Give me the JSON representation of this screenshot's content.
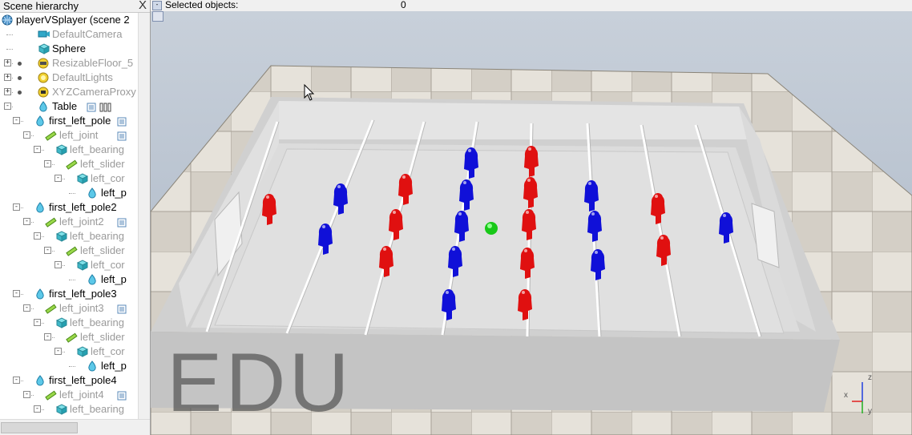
{
  "hierarchy": {
    "title": "Scene hierarchy",
    "close": "X",
    "items": [
      {
        "label": "playerVSplayer (scene 2",
        "icon": "world-icon",
        "color": "black"
      },
      {
        "label": "DefaultCamera",
        "icon": "camera-icon",
        "color": "gray"
      },
      {
        "label": "Sphere",
        "icon": "cube-icon",
        "color": "black"
      },
      {
        "label": "ResizableFloor_5",
        "icon": "floor-icon",
        "color": "gray"
      },
      {
        "label": "DefaultLights",
        "icon": "lights-icon",
        "color": "gray"
      },
      {
        "label": "XYZCameraProxy",
        "icon": "proxy-icon",
        "color": "gray"
      },
      {
        "label": "Table",
        "icon": "shape-icon",
        "color": "black"
      },
      {
        "label": "first_left_pole",
        "icon": "shape-icon",
        "color": "black"
      },
      {
        "label": "left_joint",
        "icon": "joint-icon",
        "color": "gray"
      },
      {
        "label": "left_bearing",
        "icon": "cube-icon",
        "color": "gray"
      },
      {
        "label": "left_slider",
        "icon": "joint-icon",
        "color": "gray"
      },
      {
        "label": "left_cor",
        "icon": "cube-icon",
        "color": "gray"
      },
      {
        "label": "left_p",
        "icon": "shape-icon",
        "color": "black"
      },
      {
        "label": "first_left_pole2",
        "icon": "shape-icon",
        "color": "black"
      },
      {
        "label": "left_joint2",
        "icon": "joint-icon",
        "color": "gray"
      },
      {
        "label": "left_bearing",
        "icon": "cube-icon",
        "color": "gray"
      },
      {
        "label": "left_slider",
        "icon": "joint-icon",
        "color": "gray"
      },
      {
        "label": "left_cor",
        "icon": "cube-icon",
        "color": "gray"
      },
      {
        "label": "left_p",
        "icon": "shape-icon",
        "color": "black"
      },
      {
        "label": "first_left_pole3",
        "icon": "shape-icon",
        "color": "black"
      },
      {
        "label": "left_joint3",
        "icon": "joint-icon",
        "color": "gray"
      },
      {
        "label": "left_bearing",
        "icon": "cube-icon",
        "color": "gray"
      },
      {
        "label": "left_slider",
        "icon": "joint-icon",
        "color": "gray"
      },
      {
        "label": "left_cor",
        "icon": "cube-icon",
        "color": "gray"
      },
      {
        "label": "left_p",
        "icon": "shape-icon",
        "color": "black"
      },
      {
        "label": "first_left_pole4",
        "icon": "shape-icon",
        "color": "black"
      },
      {
        "label": "left_joint4",
        "icon": "joint-icon",
        "color": "gray"
      },
      {
        "label": "left_bearing",
        "icon": "cube-icon",
        "color": "gray"
      }
    ]
  },
  "status": {
    "selected_label": "Selected objects:",
    "selected_count": "0"
  },
  "viewport": {
    "watermark": "EDU",
    "axes": {
      "x": "x",
      "y": "y",
      "z": "z"
    },
    "colors": {
      "red_team": "#e01010",
      "blue_team": "#1010d8",
      "ball": "#10c010",
      "table": "#d8d8d8",
      "floor_light": "#e8e4dc",
      "floor_dark": "#9c968c",
      "background": "#a4b4c8"
    }
  }
}
